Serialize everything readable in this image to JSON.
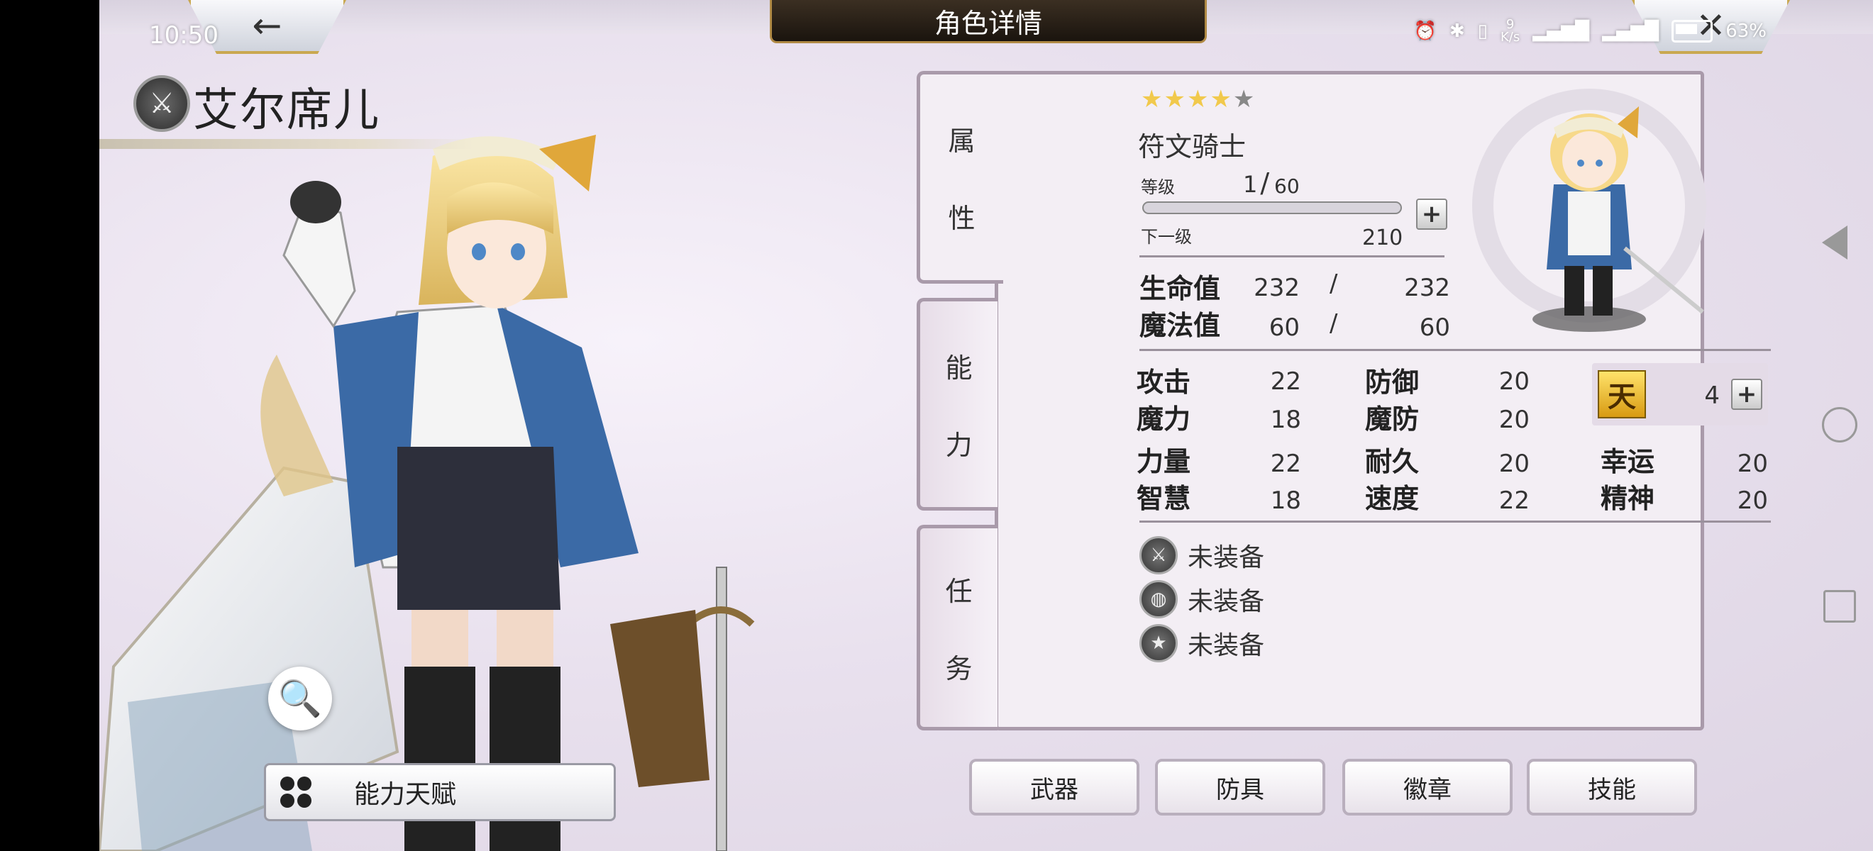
{
  "status_bar": {
    "time": "10:50",
    "net_speed": "9\nK/s",
    "battery": "63%"
  },
  "header": {
    "title": "角色详情",
    "back_icon": "←",
    "close_icon": "✕"
  },
  "character": {
    "name": "艾尔席儿",
    "class": "符文骑士",
    "stars_on": "★★★★",
    "stars_off": "★",
    "level_label": "等级",
    "level": "1",
    "level_max": "60",
    "level_sep": "/",
    "next_label": "下一级",
    "next_exp": "210",
    "exp_progress": 0.0
  },
  "tabs": {
    "attributes": [
      "属",
      "性"
    ],
    "abilities": [
      "能",
      "力"
    ],
    "quests": [
      "任",
      "务"
    ]
  },
  "stats": {
    "hp": {
      "label": "生命值",
      "cur": "232",
      "max": "232"
    },
    "mp": {
      "label": "魔法值",
      "cur": "60",
      "max": "60"
    },
    "atk": {
      "label": "攻击",
      "val": "22"
    },
    "def": {
      "label": "防御",
      "val": "20"
    },
    "mag": {
      "label": "魔力",
      "val": "18"
    },
    "mdef": {
      "label": "魔防",
      "val": "20"
    },
    "str": {
      "label": "力量",
      "val": "22"
    },
    "end": {
      "label": "耐久",
      "val": "20"
    },
    "luck": {
      "label": "幸运",
      "val": "20"
    },
    "int": {
      "label": "智慧",
      "val": "18"
    },
    "spd": {
      "label": "速度",
      "val": "22"
    },
    "spirit": {
      "label": "精神",
      "val": "20"
    },
    "slash": "/"
  },
  "talent_points": {
    "glyph": "天",
    "value": "4"
  },
  "equipment": [
    {
      "icon": "sword-icon",
      "label": "未装备"
    },
    {
      "icon": "armor-icon",
      "label": "未装备"
    },
    {
      "icon": "badge-icon",
      "label": "未装备"
    }
  ],
  "buttons": {
    "ability_talent": "能力天赋",
    "weapon": "武器",
    "armor": "防具",
    "badge": "徽章",
    "skill": "技能"
  }
}
